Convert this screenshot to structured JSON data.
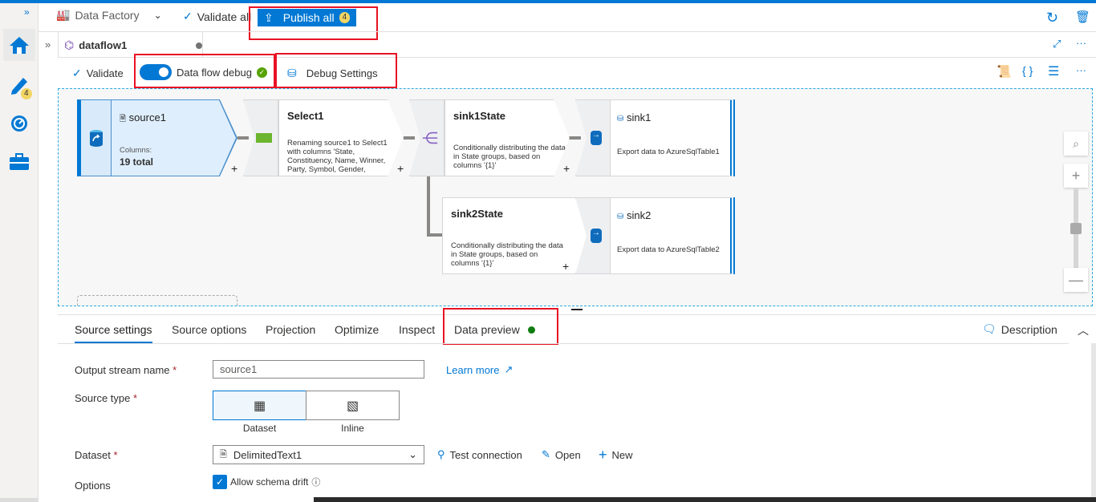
{
  "header": {
    "factory": "Data Factory",
    "validate_all": "Validate all",
    "publish_all": "Publish all",
    "publish_count": "4"
  },
  "rail": {
    "author_badge": "4"
  },
  "tab": {
    "name": "dataflow1"
  },
  "toolbar": {
    "validate": "Validate",
    "debug_label": "Data flow debug",
    "debug_on": true,
    "debug_settings": "Debug Settings"
  },
  "nodes": {
    "source1": {
      "title": "source1",
      "columns_label": "Columns:",
      "columns_value": "19 total"
    },
    "select1": {
      "title": "Select1",
      "desc": "Renaming source1 to Select1 with columns 'State, Constituency, Name, Winner, Party, Symbol, Gender,"
    },
    "sink1State": {
      "title": "sink1State",
      "desc": "Conditionally distributing the data in State groups, based on columns '{1}'"
    },
    "sink1": {
      "title": "sink1",
      "desc": "Export data to AzureSqlTable1"
    },
    "sink2State": {
      "title": "sink2State",
      "desc": "Conditionally distributing the data in State groups, based on columns '{1}'"
    },
    "sink2": {
      "title": "sink2",
      "desc": "Export data to AzureSqlTable2"
    }
  },
  "panel": {
    "tabs": [
      "Source settings",
      "Source options",
      "Projection",
      "Optimize",
      "Inspect",
      "Data preview"
    ],
    "active_tab": "Source settings",
    "description": "Description",
    "output_stream_label": "Output stream name",
    "output_stream_value": "source1",
    "learn_more": "Learn more",
    "source_type_label": "Source type",
    "source_types": [
      "Dataset",
      "Inline"
    ],
    "source_type_selected": "Dataset",
    "dataset_label": "Dataset",
    "dataset_value": "DelimitedText1",
    "test_connection": "Test connection",
    "open": "Open",
    "new": "New",
    "options_label": "Options",
    "allow_schema_drift": "Allow schema drift",
    "allow_schema_drift_checked": true,
    "required_mark": "*"
  }
}
